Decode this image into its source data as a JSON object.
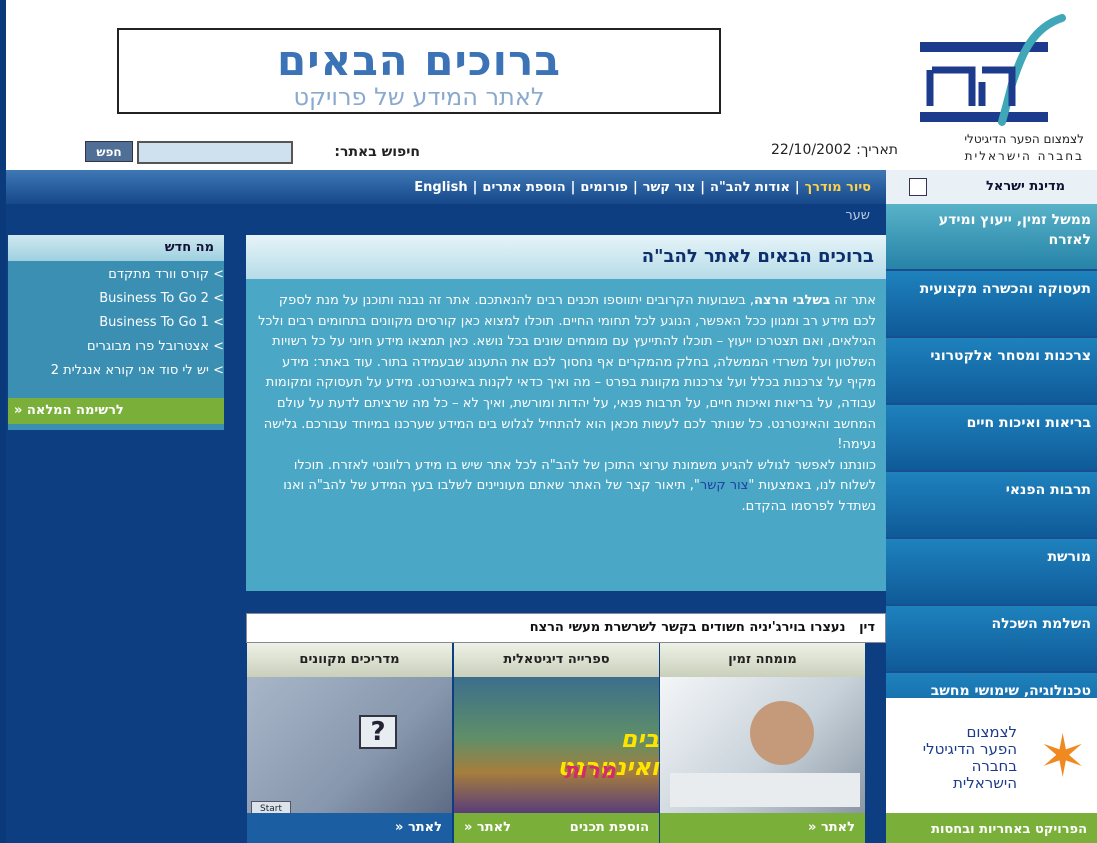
{
  "header": {
    "banner_line1": "ברוכים הבאים",
    "banner_line2": "לאתר המידע של פרויקט",
    "logo_line1": "לצמצום הפער הדיגיטלי",
    "logo_line2": "בחברה הישראלית",
    "search_label": "חיפוש באתר:",
    "search_button": "חפש",
    "search_value": "",
    "date": "תאריך: 22/10/2002"
  },
  "nav": {
    "items": [
      "סיור מודרך",
      "אודות להב\"ה",
      "צור קשר",
      "פורומים",
      "הוספת אתרים",
      "English"
    ],
    "mdina": "מדינת ישראל",
    "breadcrumb": "שער"
  },
  "right_menu": [
    "ממשל זמין, ייעוץ ומידע לאזרח",
    "תעסוקה והכשרה מקצועית",
    "צרכנות ומסחר אלקטרוני",
    "בריאות ואיכות חיים",
    "תרבות הפנאי",
    "מורשת",
    "השלמת השכלה",
    "טכנולוגיה, שימושי מחשב ואינטרנט"
  ],
  "right_logo": {
    "line1": "לצמצום",
    "line2": "הפער הדיגיטלי",
    "line3": "בחברה",
    "line4": "הישראלית",
    "footer": "הפרויקט באחריות ובחסות"
  },
  "whats_new": {
    "title": "מה חדש",
    "items": [
      "קורס וורד מתקדם",
      "Business To Go 2",
      "Business To Go 1",
      "אצטרובל פרו מבוגרים",
      "יש לי סוד אני קורא אנגלית 2"
    ],
    "more": "לרשימה המלאה «"
  },
  "welcome": {
    "title": "ברוכים הבאים לאתר להב\"ה",
    "p1_a": "אתר זה ",
    "p1_bold": "בשלבי הרצה",
    "p1_b": ", בשבועות הקרובים יתווספו תכנים רבים להנאתכם. אתר זה נבנה ותוכנן על מנת לספק לכם מידע רב ומגוון ככל האפשר, הנוגע לכל תחומי החיים. תוכלו למצוא כאן קורסים מקוונים בתחומים רבים ולכל הגילאים, ואם תצטרכו ייעוץ – תוכלו להתייעץ עם מומחים שונים בכל נושא. כאן תמצאו מידע חיוני על כל רשויות השלטון ועל משרדי הממשלה, בחלק מהמקרים אף נחסוך לכם את התענוג שבעמידה בתור. עוד באתר: מידע מקיף על צרכנות בכלל ועל צרכנות מקוונת בפרט – מה ואיך כדאי לקנות באינטרנט. מידע על תעסוקה ומקומות עבודה, על בריאות ואיכות חיים, על תרבות פנאי, על יהדות ומורשת, ואיך לא – כל מה שרציתם לדעת על עולם המחשב והאינטרנט. כל שנותר לכם לעשות מכאן הוא להתחיל לגלוש בים המידע שערכנו במיוחד עבורכם. גלישה נעימה!",
    "p2_a": "כוונתנו לאפשר לגולש להגיע משמונת ערוצי התוכן של להב\"ה לכל אתר שיש בו מידע רלוונטי לאזרח. תוכלו לשלוח לנו, באמצעות \"",
    "p2_link": "צור קשר",
    "p2_b": "\", תיאור קצר של האתר שאתם מעוניינים לשלבו בעץ המידע של להב\"ה ואנו נשתדל לפרסמו בהקדם."
  },
  "news": {
    "label": "דין",
    "text": "נעצרו בוירג'יניה חשודים בקשר לשרשרת מעשי הרצח"
  },
  "columns": [
    {
      "title": "מומחה זמין",
      "foot": "לאתר «",
      "foot_extra": ""
    },
    {
      "title": "ספרייה דיגיטאלית",
      "foot": "לאתר «",
      "foot_extra": "הוספת תכנים"
    },
    {
      "title": "מדריכים מקוונים",
      "foot": "לאתר «",
      "foot_extra": ""
    }
  ],
  "images": {
    "digital_line1": "בים ואינטרנט",
    "digital_line2": "מרות",
    "start_label": "Start"
  },
  "colors": {
    "nav_blue": "#16488a",
    "main_blue": "#0d3e82",
    "panel_teal": "#4aa7c5",
    "green": "#7ab03a"
  }
}
